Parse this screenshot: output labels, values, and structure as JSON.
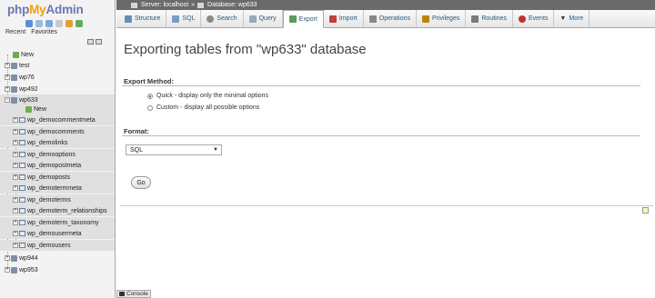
{
  "logo": {
    "php": "php",
    "my": "My",
    "admin": "Admin"
  },
  "nav": {
    "tabs": [
      "Recent",
      "Favorites"
    ],
    "new_label": "New",
    "databases": [
      {
        "name": "test"
      },
      {
        "name": "wp76"
      },
      {
        "name": "wp492"
      },
      {
        "name": "wp633"
      },
      {
        "name": "wp944"
      },
      {
        "name": "wp953"
      }
    ],
    "wp633_new": "New",
    "wp633_tables": [
      "wp_democommentmeta",
      "wp_democomments",
      "wp_demolinks",
      "wp_demooptions",
      "wp_demopostmeta",
      "wp_demoposts",
      "wp_demotermmeta",
      "wp_demoterms",
      "wp_demoterm_relationships",
      "wp_demoterm_taxonomy",
      "wp_demousermeta",
      "wp_demousers"
    ]
  },
  "breadcrumb": {
    "server": "Server: localhost",
    "separator": "»",
    "database": "Database: wp633"
  },
  "tabs": [
    {
      "label": "Structure",
      "icon": "structure-icon",
      "color": "#6b8cb8"
    },
    {
      "label": "SQL",
      "icon": "sql-icon",
      "color": "#7a9cc6"
    },
    {
      "label": "Search",
      "icon": "search-icon",
      "color": "#8a8a8a"
    },
    {
      "label": "Query",
      "icon": "query-icon",
      "color": "#9aa8b8"
    },
    {
      "label": "Export",
      "icon": "export-icon",
      "color": "#5a9a5a"
    },
    {
      "label": "Import",
      "icon": "import-icon",
      "color": "#c04040"
    },
    {
      "label": "Operations",
      "icon": "wrench-icon",
      "color": "#888888"
    },
    {
      "label": "Privileges",
      "icon": "users-icon",
      "color": "#b8860b"
    },
    {
      "label": "Routines",
      "icon": "routines-icon",
      "color": "#7a7a7a"
    },
    {
      "label": "Events",
      "icon": "clock-icon",
      "color": "#c03030"
    },
    {
      "label": "More",
      "icon": "chevron-down-icon",
      "color": "#333333"
    }
  ],
  "active_tab": "Export",
  "main": {
    "title": "Exporting tables from \"wp633\" database",
    "export_method_label": "Export Method:",
    "method_options": [
      {
        "label": "Quick - display only the minimal options",
        "selected": true
      },
      {
        "label": "Custom - display all possible options",
        "selected": false
      }
    ],
    "format_label": "Format:",
    "format_value": "SQL",
    "go_label": "Go"
  },
  "console": {
    "label": "Console"
  }
}
